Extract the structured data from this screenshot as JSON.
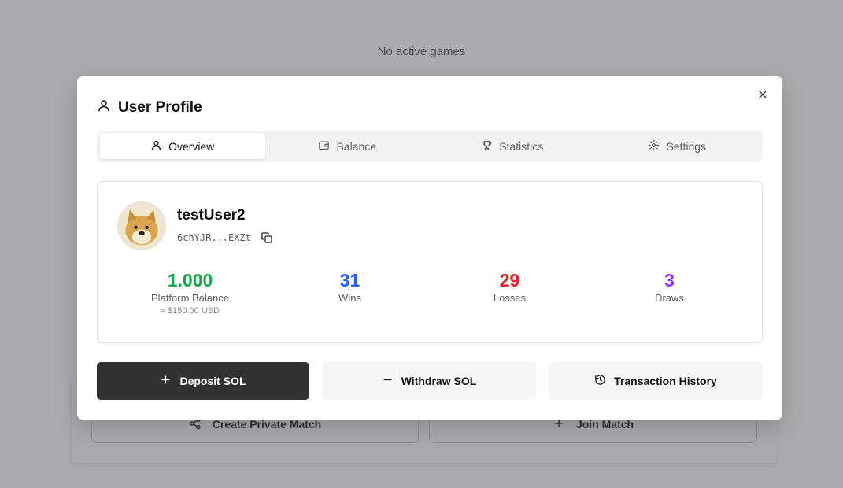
{
  "background": {
    "empty_text": "No active games",
    "create_private_match_label": "Create Private Match",
    "join_match_label": "Join Match"
  },
  "modal": {
    "title": "User Profile",
    "tabs": [
      {
        "label": "Overview",
        "icon": "user-icon",
        "active": true
      },
      {
        "label": "Balance",
        "icon": "wallet-icon",
        "active": false
      },
      {
        "label": "Statistics",
        "icon": "trophy-icon",
        "active": false
      },
      {
        "label": "Settings",
        "icon": "gear-icon",
        "active": false
      }
    ],
    "profile": {
      "username": "testUser2",
      "wallet_address": "6chYJR...EXZt"
    },
    "stats": [
      {
        "value": "1.000",
        "label": "Platform Balance",
        "sub": "≈ $150.00 USD",
        "color": "#16a34a"
      },
      {
        "value": "31",
        "label": "Wins",
        "color": "#2563eb"
      },
      {
        "value": "29",
        "label": "Losses",
        "color": "#dc2626"
      },
      {
        "value": "3",
        "label": "Draws",
        "color": "#9333ea"
      }
    ],
    "actions": {
      "deposit_label": "Deposit SOL",
      "withdraw_label": "Withdraw SOL",
      "history_label": "Transaction History"
    }
  }
}
